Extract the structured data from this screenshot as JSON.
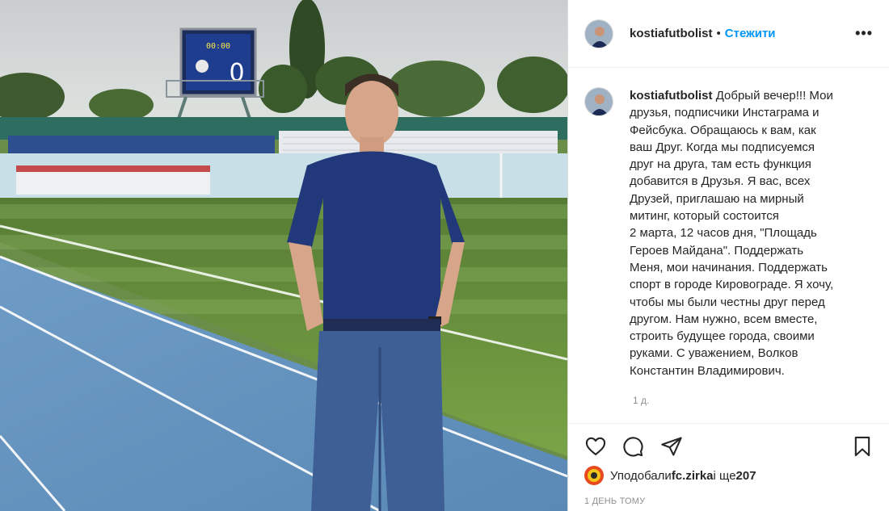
{
  "post": {
    "image_description_icon": "stadium-photo",
    "username": "kostiafutbolist",
    "dot": "•",
    "follow_label": "Стежити",
    "more_icon": "more-options-icon",
    "more_label": "•••",
    "caption_text": "Добрый вечер!!! Мои\nдрузья, подписчики Инстаграма и\nФейсбука. Обращаюсь к вам, как\nваш Друг. Когда мы подписуемся\nдруг на друга, там есть функция\nдобавится в Друзья. Я вас, всех\nДрузей, приглашаю на мирный\nмитинг, который состоится\n2 марта, 12 часов дня, \"Площадь\nГероев Майдана\". Поддержать\nМеня, мои начинания. Поддержать\nспорт в городе Кировограде. Я хочу,\nчтобы мы были честны друг перед\nдругом. Нам нужно, всем вместе,\nстроить будущее города, своими\nруками. С уважением, Волков\nКонстантин Владимирович.",
    "relative_time": "1 д.",
    "likes_prefix": "Уподобали ",
    "likes_user": "fc.zirka",
    "likes_middle": " і ще ",
    "likes_count": "207",
    "date_label": "1 ДЕНЬ ТОМУ",
    "scoreboard": {
      "left": "00:00",
      "score": "0"
    }
  },
  "colors": {
    "accent": "#0095f6",
    "text": "#262626",
    "muted": "#8e8e8e"
  }
}
